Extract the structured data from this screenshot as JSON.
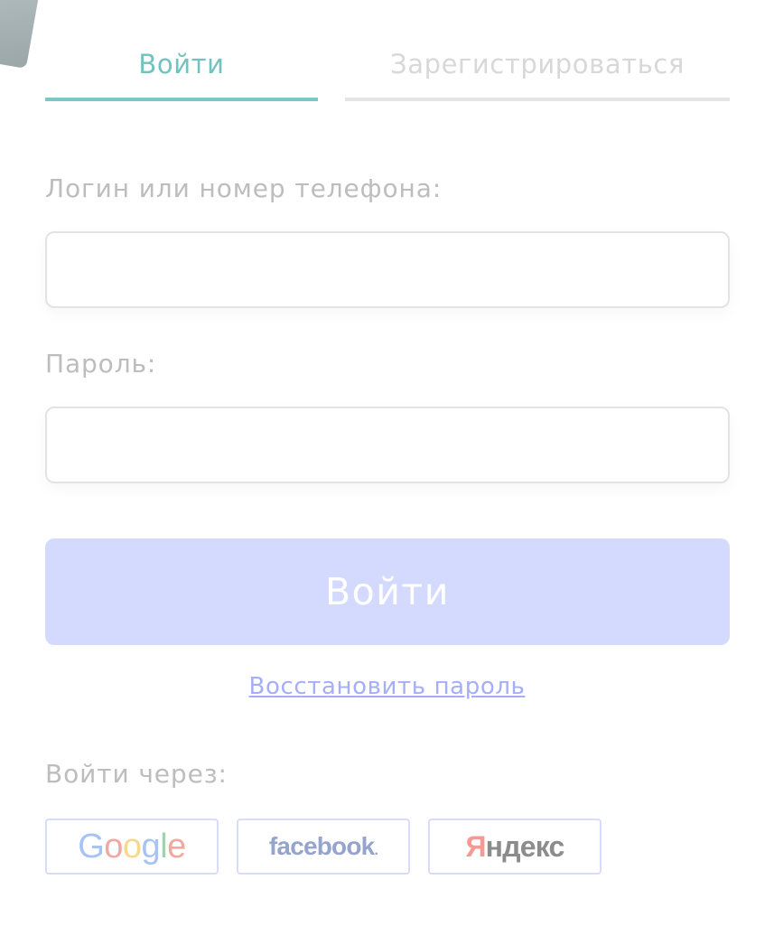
{
  "tabs": {
    "login_label": "Войти",
    "register_label": "Зарегистрироваться"
  },
  "form": {
    "login_label": "Логин или номер телефона:",
    "login_value": "",
    "login_placeholder": "",
    "password_label": "Пароль:",
    "password_value": "",
    "password_placeholder": "",
    "submit_label": "Войти",
    "restore_link": "Восстановить пароль"
  },
  "social": {
    "label": "Войти через:",
    "google_letters": [
      "G",
      "o",
      "o",
      "g",
      "l",
      "e"
    ],
    "facebook_text": "facebook",
    "facebook_dot": ".",
    "yandex_first": "Я",
    "yandex_rest": "ндекс"
  },
  "colors": {
    "accent_teal": "#7cc7c2",
    "button_bg": "#d4dafe",
    "link": "#a6aef9"
  }
}
